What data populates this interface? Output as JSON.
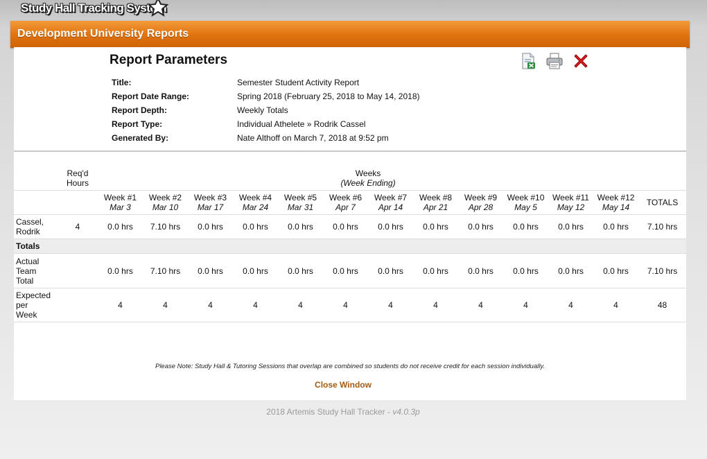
{
  "app": {
    "logo_text": "Study Hall Tracking System",
    "banner_title": "Development University Reports"
  },
  "report": {
    "heading": "Report Parameters",
    "params": [
      {
        "label": "Title:",
        "value": "Semester Student Activity Report"
      },
      {
        "label": "Report Date Range:",
        "value": "Spring 2018 (February 25, 2018 to May 14, 2018)"
      },
      {
        "label": "Report Depth:",
        "value": "Weekly Totals"
      },
      {
        "label": "Report Type:",
        "value": "Individual Athelete » Rodrik Cassel"
      },
      {
        "label": "Generated By:",
        "value": "Nate Althoff on March 7, 2018 at 9:52 pm"
      }
    ],
    "toolbar": {
      "excel_icon": "excel-export-icon",
      "print_icon": "printer-icon",
      "close_icon": "red-x-close-icon"
    }
  },
  "table": {
    "req_header_line1": "Req'd",
    "req_header_line2": "Hours",
    "weeks_header": "Weeks",
    "weeks_sub": "(Week Ending)",
    "totals_header": "TOTALS",
    "weeks": [
      {
        "label": "Week #1",
        "ending": "Mar 3"
      },
      {
        "label": "Week #2",
        "ending": "Mar 10"
      },
      {
        "label": "Week #3",
        "ending": "Mar 17"
      },
      {
        "label": "Week #4",
        "ending": "Mar 24"
      },
      {
        "label": "Week #5",
        "ending": "Mar 31"
      },
      {
        "label": "Week #6",
        "ending": "Apr 7"
      },
      {
        "label": "Week #7",
        "ending": "Apr 14"
      },
      {
        "label": "Week #8",
        "ending": "Apr 21"
      },
      {
        "label": "Week #9",
        "ending": "Apr 28"
      },
      {
        "label": "Week #10",
        "ending": "May 5"
      },
      {
        "label": "Week #11",
        "ending": "May 12"
      },
      {
        "label": "Week #12",
        "ending": "May 14"
      }
    ],
    "student": {
      "name_line1": "Cassel,",
      "name_line2": "Rodrik",
      "req": "4",
      "values": [
        "0.0 hrs",
        "7.10 hrs",
        "0.0 hrs",
        "0.0 hrs",
        "0.0 hrs",
        "0.0 hrs",
        "0.0 hrs",
        "0.0 hrs",
        "0.0 hrs",
        "0.0 hrs",
        "0.0 hrs",
        "0.0 hrs"
      ],
      "total": "7.10 hrs"
    },
    "totals_label": "Totals",
    "actual": {
      "label_lines": [
        "Actual",
        "Team",
        "Total"
      ],
      "values": [
        "0.0 hrs",
        "7.10 hrs",
        "0.0 hrs",
        "0.0 hrs",
        "0.0 hrs",
        "0.0 hrs",
        "0.0 hrs",
        "0.0 hrs",
        "0.0 hrs",
        "0.0 hrs",
        "0.0 hrs",
        "0.0 hrs"
      ],
      "total": "7.10 hrs"
    },
    "expected": {
      "label_lines": [
        "Expected",
        "per",
        "Week"
      ],
      "values": [
        "4",
        "4",
        "4",
        "4",
        "4",
        "4",
        "4",
        "4",
        "4",
        "4",
        "4",
        "4"
      ],
      "total": "48"
    }
  },
  "note": "Please Note: Study Hall & Tutoring Sessions that overlap are combined so students do not receive credit for each session individually.",
  "close_window": "Close Window",
  "footer": {
    "text": "2018 Artemis Study Hall Tracker - ",
    "version": "v4.0.3p"
  }
}
